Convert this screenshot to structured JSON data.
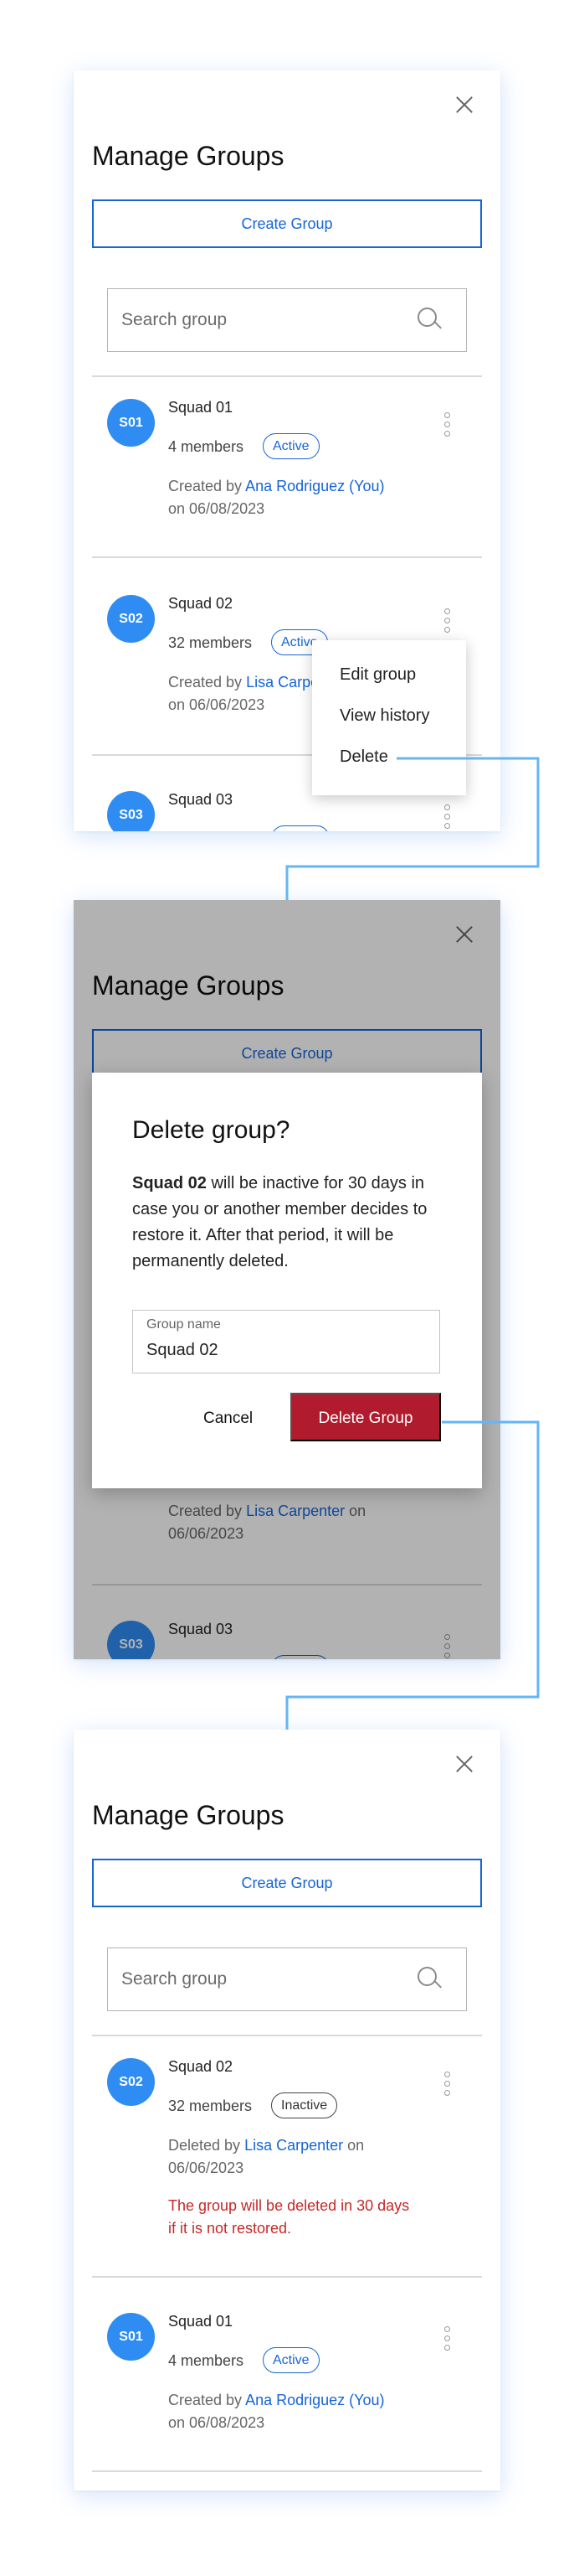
{
  "panel1": {
    "title": "Manage Groups",
    "create_label": "Create Group",
    "search_placeholder": "Search group",
    "groups": [
      {
        "initials": "S01",
        "name": "Squad 01",
        "members": "4 members",
        "status": "Active",
        "meta_prefix": "Created by",
        "person": "Ana Rodriguez (You)",
        "meta_suffix": "on 06/08/2023"
      },
      {
        "initials": "S02",
        "name": "Squad 02",
        "members": "32 members",
        "status": "Active",
        "meta_prefix": "Created by",
        "person": "Lisa Carpenter",
        "meta_suffix": "on 06/06/2023"
      },
      {
        "initials": "S03",
        "name": "Squad 03"
      }
    ],
    "menu": [
      "Edit group",
      "View history",
      "Delete"
    ]
  },
  "panel2": {
    "title": "Manage Groups",
    "create_label": "Create Group",
    "dialog": {
      "title": "Delete group?",
      "body_group": "Squad 02",
      "body_text": "will be inactive for 30 days in case you or another member decides to restore it. After that period, it will be permanently deleted.",
      "field_label": "Group name",
      "field_value": "Squad 02",
      "cancel_label": "Cancel",
      "delete_label": "Delete Group"
    },
    "behind": {
      "meta_prefix": "Created by",
      "person": "Lisa Carpenter",
      "meta_suffix": "on 06/06/2023",
      "next_initials": "S03",
      "next_name": "Squad 03"
    }
  },
  "panel3": {
    "title": "Manage Groups",
    "create_label": "Create Group",
    "search_placeholder": "Search group",
    "groups": [
      {
        "initials": "S02",
        "name": "Squad 02",
        "members": "32 members",
        "status": "Inactive",
        "meta_prefix": "Deleted by",
        "person": "Lisa Carpenter",
        "meta_suffix": "on 06/06/2023",
        "warning": "The group will be deleted in 30 days if it is not restored."
      },
      {
        "initials": "S01",
        "name": "Squad 01",
        "members": "4 members",
        "status": "Active",
        "meta_prefix": "Created by",
        "person": "Ana Rodriguez (You)",
        "meta_suffix": "on 06/08/2023"
      }
    ]
  },
  "colors": {
    "accent": "#1565d8",
    "avatar": "#2f8cf2",
    "danger": "#b01c2e",
    "warning_text": "#c62828",
    "connector": "#64b5f6"
  },
  "icons": [
    "close-icon",
    "search-icon",
    "kebab-menu-icon"
  ]
}
